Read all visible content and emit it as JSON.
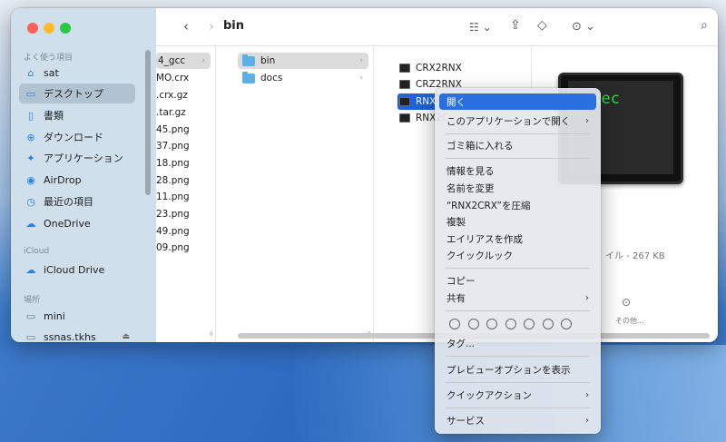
{
  "sidebar": {
    "sections": {
      "favorites": "よく使う項目",
      "icloud": "iCloud",
      "locations": "場所"
    },
    "items": [
      {
        "label": "sat",
        "icon": "home-icon"
      },
      {
        "label": "デスクトップ",
        "icon": "desktop-icon"
      },
      {
        "label": "書類",
        "icon": "document-icon"
      },
      {
        "label": "ダウンロード",
        "icon": "download-icon"
      },
      {
        "label": "アプリケーション",
        "icon": "applications-icon"
      },
      {
        "label": "AirDrop",
        "icon": "airdrop-icon"
      },
      {
        "label": "最近の項目",
        "icon": "clock-icon"
      },
      {
        "label": "OneDrive",
        "icon": "cloud-icon"
      }
    ],
    "icloud_items": [
      {
        "label": "iCloud Drive",
        "icon": "icloud-icon"
      }
    ],
    "location_items": [
      {
        "label": "mini",
        "icon": "drive-icon"
      },
      {
        "label": "ssnas.tkhs",
        "icon": "server-icon"
      }
    ]
  },
  "toolbar": {
    "title": "bin"
  },
  "columns": {
    "col1": [
      "4_gcc",
      "MO.crx",
      ".crx.gz",
      ".tar.gz",
      "45.png",
      "37.png",
      "18.png",
      "28.png",
      "11.png",
      "23.png",
      "49.png",
      "09.png"
    ],
    "col2": [
      "bin",
      "docs"
    ],
    "col3": [
      "CRX2RNX",
      "CRZ2RNX",
      "RNX2CRX",
      "RNX2C"
    ]
  },
  "preview": {
    "screen_text": "exec",
    "meta": "イル - 267 KB",
    "more_label": "その他..."
  },
  "context_menu": {
    "open": "開く",
    "open_with": "このアプリケーションで開く",
    "trash": "ゴミ箱に入れる",
    "get_info": "情報を見る",
    "rename": "名前を変更",
    "compress": "“RNX2CRX”を圧縮",
    "duplicate": "複製",
    "make_alias": "エイリアスを作成",
    "quick_look": "クイックルック",
    "copy": "コピー",
    "share": "共有",
    "tags": "タグ...",
    "preview_options": "プレビューオプションを表示",
    "quick_actions": "クイックアクション",
    "services": "サービス"
  }
}
